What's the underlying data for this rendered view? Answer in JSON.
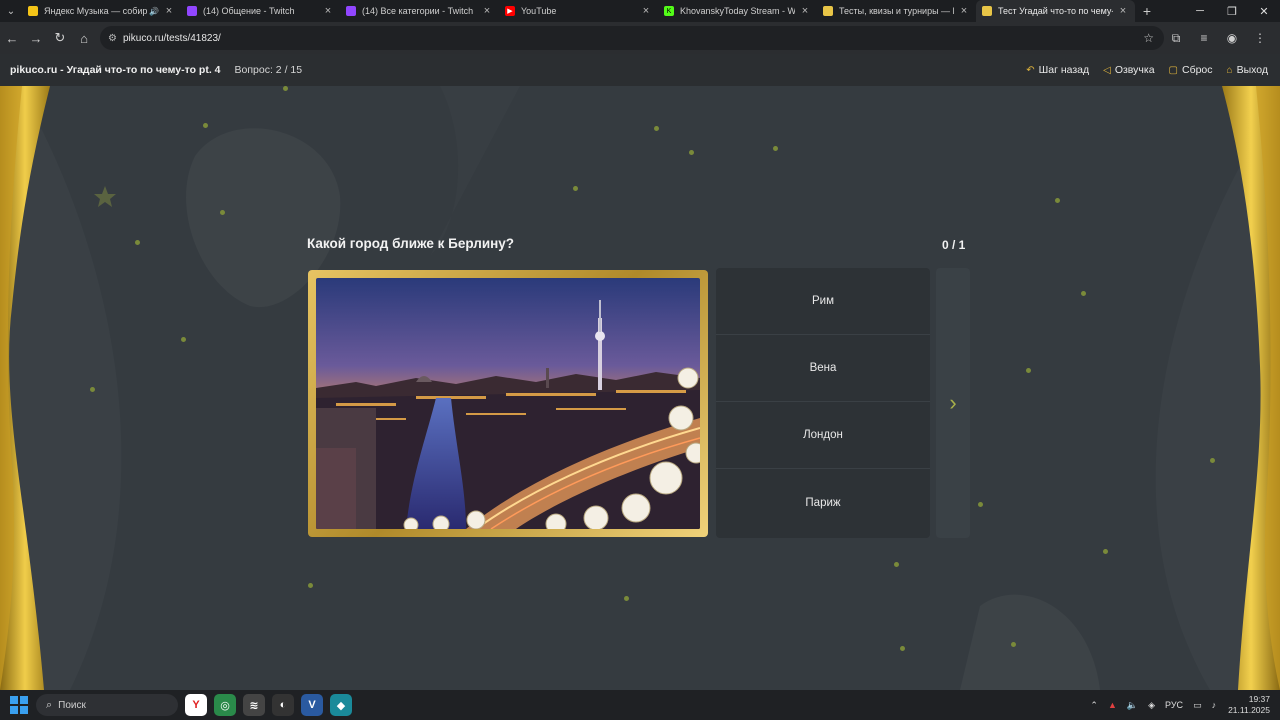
{
  "browser": {
    "tabs": [
      {
        "title": "Яндекс Музыка — собираем",
        "favicon_color": "#f5c518",
        "audio": true,
        "active": false
      },
      {
        "title": "(14) Общение - Twitch",
        "favicon_color": "#9146ff",
        "audio": false,
        "active": false
      },
      {
        "title": "(14) Все категории - Twitch",
        "favicon_color": "#9146ff",
        "audio": false,
        "active": false
      },
      {
        "title": "YouTube",
        "favicon_color": "#ff0000",
        "audio": false,
        "active": false
      },
      {
        "title": "KhovanskyToday Stream - Watc",
        "favicon_color": "#53fc18",
        "audio": false,
        "active": false
      },
      {
        "title": "Тесты, квизы и турниры — Pik",
        "favicon_color": "#e8c547",
        "audio": false,
        "active": false
      },
      {
        "title": "Тест Угадай что-то по чему-то",
        "favicon_color": "#e8c547",
        "audio": false,
        "active": true
      }
    ],
    "url": "pikuco.ru/tests/41823/"
  },
  "header": {
    "title": "pikuco.ru - Угадай что-то по чему-то pt. 4",
    "question_counter": "Вопрос: 2 / 15",
    "actions": [
      {
        "label": "Шаг назад",
        "icon": "undo-icon"
      },
      {
        "label": "Озвучка",
        "icon": "speaker-icon"
      },
      {
        "label": "Сброс",
        "icon": "reset-icon"
      },
      {
        "label": "Выход",
        "icon": "home-icon"
      }
    ]
  },
  "quiz": {
    "question": "Какой город ближе к Берлину?",
    "score": "0 / 1",
    "answers": [
      "Рим",
      "Вена",
      "Лондон",
      "Париж"
    ],
    "image_subject": "Berlin skyline at dusk with TV tower"
  },
  "taskbar": {
    "search_placeholder": "Поиск",
    "language": "РУС",
    "time": "19:37",
    "date": "21.11.2025"
  },
  "colors": {
    "accent": "#e0b43c",
    "stage_bg": "#353b40",
    "answers_bg": "#2d3236"
  }
}
